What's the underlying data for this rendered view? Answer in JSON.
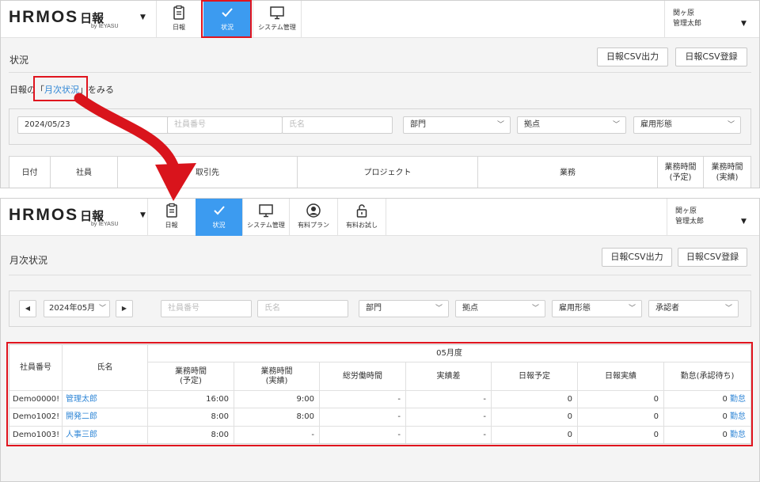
{
  "brand": {
    "word": "HRMOS",
    "product": "日報",
    "sub": "by IEYASU"
  },
  "top": {
    "nav": [
      {
        "label": "日報",
        "icon": "clipboard-icon"
      },
      {
        "label": "状況",
        "icon": "check-icon"
      },
      {
        "label": "システム管理",
        "icon": "monitor-icon"
      }
    ],
    "user": {
      "company": "関ヶ原",
      "name": "管理太郎"
    },
    "page_title": "状況",
    "csv_export": "日報CSV出力",
    "csv_import": "日報CSV登録",
    "monthly_link": {
      "prefix": "日報の",
      "open": "「",
      "link": "月次状況",
      "close": "」",
      "suffix": "をみる"
    },
    "filters": {
      "date": "2024/05/23",
      "employee_no_placeholder": "社員番号",
      "name_placeholder": "氏名",
      "department": "部門",
      "location": "拠点",
      "employment_type": "雇用形態"
    },
    "columns": [
      "日付",
      "社員",
      "取引先",
      "プロジェクト",
      "業務",
      "業務時間\n(予定)",
      "業務時間\n(実績)"
    ]
  },
  "bottom": {
    "nav": [
      {
        "label": "日報",
        "icon": "clipboard-icon"
      },
      {
        "label": "状況",
        "icon": "check-icon"
      },
      {
        "label": "システム管理",
        "icon": "monitor-icon"
      },
      {
        "label": "有料プラン",
        "icon": "user-circle-icon"
      },
      {
        "label": "有料お試し",
        "icon": "unlock-icon"
      }
    ],
    "user": {
      "company": "関ヶ原",
      "name": "管理太郎"
    },
    "page_title": "月次状況",
    "csv_export": "日報CSV出力",
    "csv_import": "日報CSV登録",
    "filters": {
      "month": "2024年05月",
      "employee_no_placeholder": "社員番号",
      "name_placeholder": "氏名",
      "department": "部門",
      "location": "拠点",
      "employment_type": "雇用形態",
      "approver": "承認者"
    },
    "table": {
      "month_header": "05月度",
      "col_employee_no": "社員番号",
      "col_name": "氏名",
      "columns": [
        "業務時間\n(予定)",
        "業務時間\n(実績)",
        "総労働時間",
        "実績差",
        "日報予定",
        "日報実績",
        "勤怠(承認待ち)"
      ],
      "rows": [
        {
          "no": "Demo0000!",
          "name": "管理太郎",
          "cells": [
            "16:00",
            "9:00",
            "-",
            "-",
            "0",
            "0",
            "0"
          ],
          "attendance": "勤怠"
        },
        {
          "no": "Demo1002!",
          "name": "開発二郎",
          "cells": [
            "8:00",
            "8:00",
            "-",
            "-",
            "0",
            "0",
            "0"
          ],
          "attendance": "勤怠"
        },
        {
          "no": "Demo1003!",
          "name": "人事三郎",
          "cells": [
            "8:00",
            "-",
            "-",
            "-",
            "0",
            "0",
            "0"
          ],
          "attendance": "勤怠"
        }
      ]
    }
  },
  "colors": {
    "accent": "#3c9bf0",
    "link": "#2f86d6",
    "highlight": "#e0141e"
  }
}
